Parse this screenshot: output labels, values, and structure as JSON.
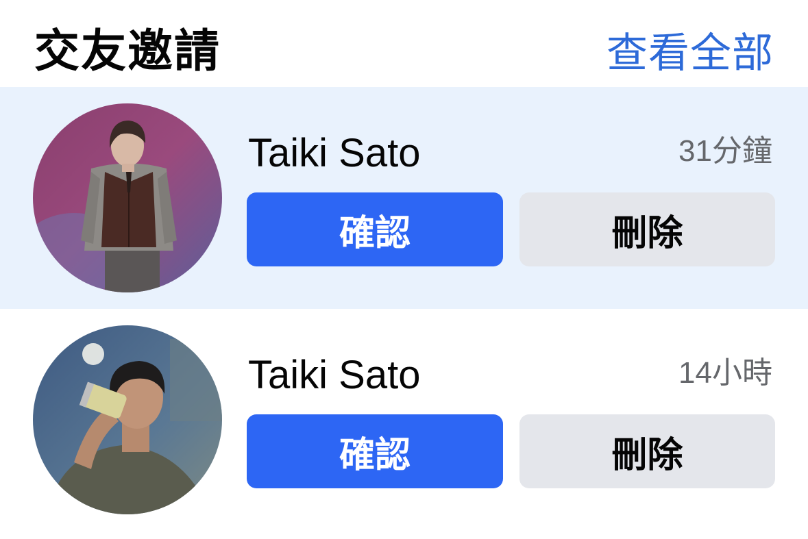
{
  "header": {
    "title": "交友邀請",
    "see_all": "查看全部"
  },
  "requests": [
    {
      "name": "Taiki Sato",
      "time": "31分鐘",
      "confirm_label": "確認",
      "delete_label": "刪除",
      "highlighted": true
    },
    {
      "name": "Taiki Sato",
      "time": "14小時",
      "confirm_label": "確認",
      "delete_label": "刪除",
      "highlighted": false
    }
  ],
  "colors": {
    "accent": "#2d6ad8",
    "confirm_bg": "#2d66f4",
    "delete_bg": "#e4e6eb",
    "highlight_bg": "#e9f2fd",
    "secondary_text": "#65676b"
  }
}
